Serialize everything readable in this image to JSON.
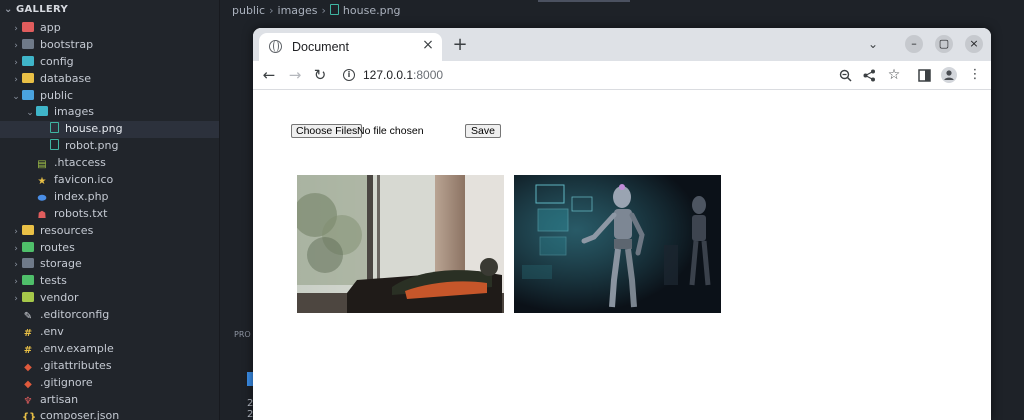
{
  "explorer": {
    "title": "GALLERY",
    "items": [
      {
        "label": "app",
        "type": "folder",
        "color": "red",
        "depth": 0,
        "expanded": false
      },
      {
        "label": "bootstrap",
        "type": "folder",
        "color": "grey",
        "depth": 0,
        "expanded": false
      },
      {
        "label": "config",
        "type": "folder",
        "color": "teal",
        "depth": 0,
        "expanded": false
      },
      {
        "label": "database",
        "type": "folder",
        "color": "yellow",
        "depth": 0,
        "expanded": false
      },
      {
        "label": "public",
        "type": "folder",
        "color": "blue",
        "depth": 0,
        "expanded": true
      },
      {
        "label": "images",
        "type": "folder",
        "color": "teal",
        "depth": 1,
        "expanded": true
      },
      {
        "label": "house.png",
        "type": "image",
        "depth": 2,
        "selected": true
      },
      {
        "label": "robot.png",
        "type": "image",
        "depth": 2
      },
      {
        "label": ".htaccess",
        "type": "file",
        "icon": "htaccess-icon",
        "depth": 1
      },
      {
        "label": "favicon.ico",
        "type": "file",
        "icon": "star-icon",
        "depth": 1
      },
      {
        "label": "index.php",
        "type": "file",
        "icon": "php-icon",
        "depth": 1
      },
      {
        "label": "robots.txt",
        "type": "file",
        "icon": "robot-icon",
        "depth": 1
      },
      {
        "label": "resources",
        "type": "folder",
        "color": "yellow",
        "depth": 0,
        "expanded": false
      },
      {
        "label": "routes",
        "type": "folder",
        "color": "green",
        "depth": 0,
        "expanded": false
      },
      {
        "label": "storage",
        "type": "folder",
        "color": "grey",
        "depth": 0,
        "expanded": false
      },
      {
        "label": "tests",
        "type": "folder",
        "color": "green",
        "depth": 0,
        "expanded": false
      },
      {
        "label": "vendor",
        "type": "folder",
        "color": "lime",
        "depth": 0,
        "expanded": false
      },
      {
        "label": ".editorconfig",
        "type": "file",
        "icon": "editorconfig-icon",
        "depth": 0
      },
      {
        "label": ".env",
        "type": "file",
        "icon": "env-icon",
        "depth": 0
      },
      {
        "label": ".env.example",
        "type": "file",
        "icon": "env-icon",
        "depth": 0
      },
      {
        "label": ".gitattributes",
        "type": "file",
        "icon": "git-icon",
        "depth": 0
      },
      {
        "label": ".gitignore",
        "type": "file",
        "icon": "git-icon",
        "depth": 0
      },
      {
        "label": "artisan",
        "type": "file",
        "icon": "laravel-icon",
        "depth": 0
      },
      {
        "label": "composer.json",
        "type": "file",
        "icon": "json-icon",
        "depth": 0
      }
    ]
  },
  "breadcrumb": {
    "parts": [
      "public",
      "images",
      "house.png"
    ]
  },
  "editor": {
    "panel_label": "PRO",
    "panel_line1": "2",
    "panel_line2": "2"
  },
  "browser": {
    "tab_title": "Document",
    "url_host": "127.0.0.1",
    "url_port": ":8000",
    "page": {
      "file_button": "Choose Files",
      "file_status": "No file chosen",
      "save_button": "Save",
      "images": [
        {
          "name": "house.png",
          "subject": "living room sofa by window"
        },
        {
          "name": "robot.png",
          "subject": "humanoid robot with holographic screens"
        }
      ]
    }
  },
  "colors": {
    "sidebar_bg": "#21252b",
    "editor_bg": "#1e2228",
    "selection": "#2c313c",
    "chrome_tabstrip": "#dee1e6",
    "accent_blue": "#3b8eea"
  }
}
